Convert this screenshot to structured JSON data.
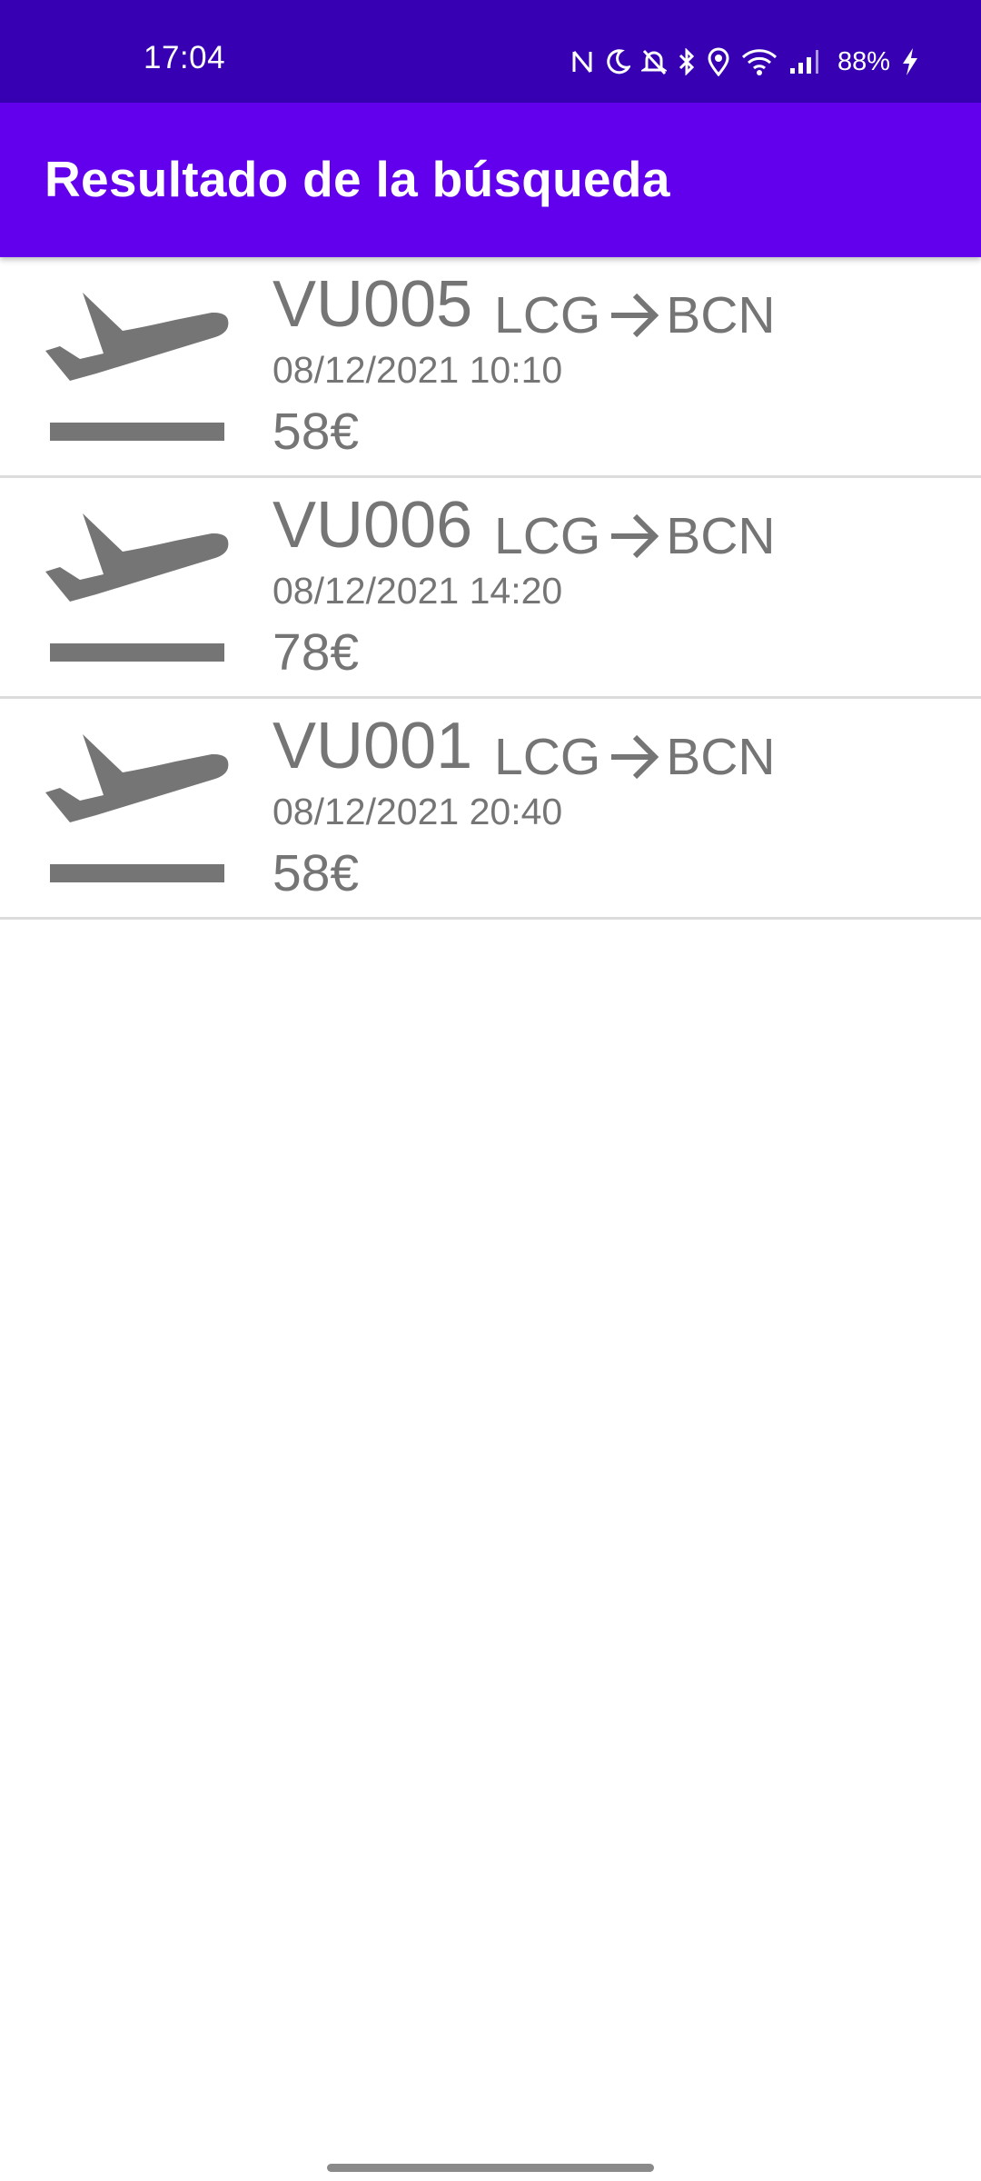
{
  "status_bar": {
    "time": "17:04",
    "battery": "88%",
    "icons": [
      "nfc-icon",
      "moon-icon",
      "bell-off-icon",
      "bluetooth-icon",
      "location-icon",
      "wifi-icon",
      "signal-icon",
      "charging-icon"
    ]
  },
  "app_bar": {
    "title": "Resultado de la búsqueda"
  },
  "colors": {
    "status_bar": "#3700b3",
    "app_bar": "#6200ee",
    "item_text": "#757575",
    "divider": "#dcdcdc"
  },
  "flights": [
    {
      "code": "VU005",
      "origin": "LCG",
      "destination": "BCN",
      "datetime": "08/12/2021 10:10",
      "price": "58€",
      "icon": "flight-takeoff-icon"
    },
    {
      "code": "VU006",
      "origin": "LCG",
      "destination": "BCN",
      "datetime": "08/12/2021 14:20",
      "price": "78€",
      "icon": "flight-takeoff-icon"
    },
    {
      "code": "VU001",
      "origin": "LCG",
      "destination": "BCN",
      "datetime": "08/12/2021 20:40",
      "price": "58€",
      "icon": "flight-takeoff-icon"
    }
  ]
}
